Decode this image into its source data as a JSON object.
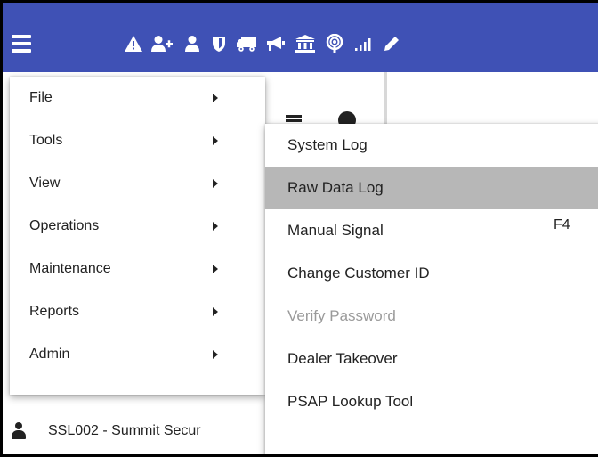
{
  "toolbar": {
    "icons": [
      "menu-icon",
      "warning-icon",
      "add-user-icon",
      "user-icon",
      "shield-icon",
      "truck-icon",
      "megaphone-icon",
      "bank-icon",
      "podcast-icon",
      "signal-icon",
      "pencil-icon"
    ],
    "color": "#3f51b5"
  },
  "main_menu": {
    "items": [
      {
        "label": "File"
      },
      {
        "label": "Tools"
      },
      {
        "label": "View"
      },
      {
        "label": "Operations"
      },
      {
        "label": "Maintenance"
      },
      {
        "label": "Reports"
      },
      {
        "label": "Admin"
      }
    ]
  },
  "sub_menu": {
    "items": [
      {
        "label": "System Log",
        "shortcut": ""
      },
      {
        "label": "Raw Data Log",
        "shortcut": "",
        "selected": true
      },
      {
        "label": "Manual Signal",
        "shortcut": "F4"
      },
      {
        "label": "Change Customer ID",
        "shortcut": ""
      },
      {
        "label": "Verify Password",
        "shortcut": "",
        "disabled": true
      },
      {
        "label": "Dealer Takeover",
        "shortcut": ""
      },
      {
        "label": "PSAP Lookup Tool",
        "shortcut": ""
      }
    ],
    "selected_color": "#b7b7b7"
  },
  "background": {
    "account_text": "SSL002 - Summit Secur"
  }
}
